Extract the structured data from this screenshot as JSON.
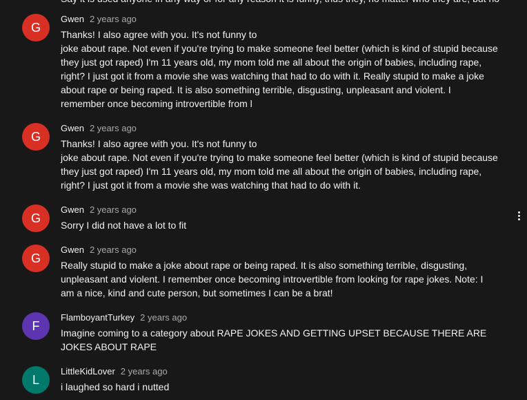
{
  "clipped_top_text": "Say it is used anyone in any way or for any reason it is funny, thus they, no matter who they are, but no",
  "comments": [
    {
      "initial": "G",
      "avatar_color": "#d93025",
      "author": "Gwen",
      "time": "2 years ago",
      "lines": [
        "Thanks! I also agree with you. It's not funny to",
        "joke about rape. Not even if you're trying to make someone feel better (which is kind of stupid because",
        "they just got raped) I'm 11 years old, my mom told me all about the origin of babies, including rape,",
        "right? I just got it from a movie she was watching that had to do with it. Really stupid to make a joke",
        "about rape or being raped. It is also something terrible, disgusting, unpleasant and violent. I",
        "remember once becoming introvertible from l"
      ]
    },
    {
      "initial": "G",
      "avatar_color": "#d93025",
      "author": "Gwen",
      "time": "2 years ago",
      "lines": [
        "Thanks! I also agree with you. It's not funny to",
        "joke about rape. Not even if you're trying to make someone feel better (which is kind of stupid because",
        "they just got raped) I'm 11 years old, my mom told me all about the origin of babies, including rape,",
        "right? I just got it from a movie she was watching that had to do with it."
      ]
    },
    {
      "initial": "G",
      "avatar_color": "#d93025",
      "author": "Gwen",
      "time": "2 years ago",
      "lines": [
        "Sorry I did not have a lot to fit"
      ],
      "has_menu": true,
      "menu_icon": "more-vertical-icon"
    },
    {
      "initial": "G",
      "avatar_color": "#d93025",
      "author": "Gwen",
      "time": "2 years ago",
      "lines": [
        "Really stupid to make a joke about rape or being raped. It is also something terrible, disgusting,",
        "unpleasant and violent. I remember once becoming introvertible from looking for rape jokes. Note: I",
        "am a nice, kind and cute person, but sometimes I can be a brat!"
      ]
    },
    {
      "initial": "F",
      "avatar_color": "#5e35b1",
      "author": "FlamboyantTurkey",
      "time": "2 years ago",
      "lines": [
        "Imagine coming to a category about RAPE JOKES AND GETTING UPSET BECAUSE THERE ARE",
        "JOKES ABOUT RAPE"
      ]
    },
    {
      "initial": "L",
      "avatar_color": "#00796b",
      "author": "LittleKidLover",
      "time": "2 years ago",
      "lines": [
        "i laughed so hard i nutted"
      ]
    }
  ]
}
